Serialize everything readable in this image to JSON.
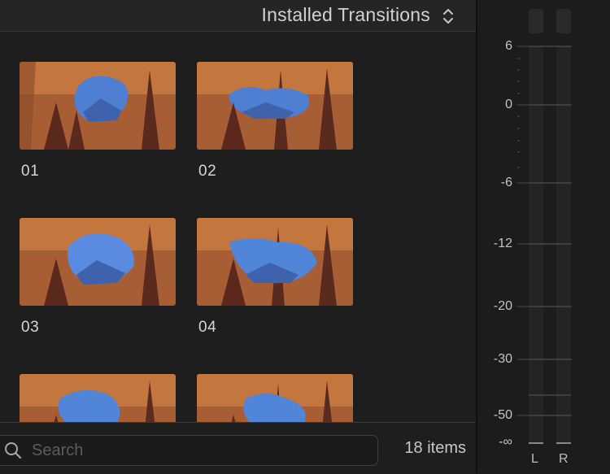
{
  "browser": {
    "title": "Installed Transitions",
    "items": [
      {
        "label": "01"
      },
      {
        "label": "02"
      },
      {
        "label": "03"
      },
      {
        "label": "04"
      },
      {
        "label": ""
      },
      {
        "label": ""
      }
    ],
    "search_placeholder": "Search",
    "item_count": "18 items"
  },
  "meters": {
    "scale": [
      "6",
      "0",
      "-6",
      "-12",
      "-20",
      "-30",
      "-50",
      "-∞"
    ],
    "channels": [
      "L",
      "R"
    ]
  }
}
